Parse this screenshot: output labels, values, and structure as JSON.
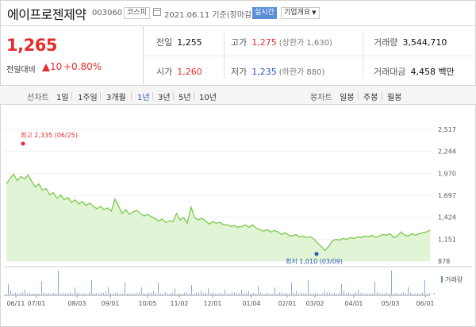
{
  "header": {
    "stock_name": "에이프로젠제약",
    "stock_code": "003060",
    "market": "코스피",
    "date_text": "2021.06.11 기준(장마감)",
    "live_label": "실시간",
    "overview_label": "기업개요"
  },
  "price": {
    "current": "1,265",
    "change_label": "전일대비",
    "change_value": "10",
    "change_pct": "+0.80%"
  },
  "stats": {
    "prev_close_label": "전일",
    "prev_close": "1,255",
    "high_label": "고가",
    "high": "1,275",
    "upper_limit": "(상한가 1,630)",
    "volume_label": "거래량",
    "volume": "3,544,710",
    "open_label": "시가",
    "open": "1,260",
    "low_label": "저가",
    "low": "1,235",
    "lower_limit": "(하한가 880)",
    "amount_label": "거래대금",
    "amount": "4,458 백만"
  },
  "toolbar": {
    "line_chart_label": "선차트",
    "periods": [
      "1일",
      "1주일",
      "3개월",
      "1년",
      "3년",
      "5년",
      "10년"
    ],
    "active_period": "1년",
    "candle_label": "봉차트",
    "candles": [
      "일봉",
      "주봉",
      "월봉"
    ]
  },
  "colors": {
    "up": "#e42d2d",
    "down": "#2859b8",
    "line": "#7cc94b",
    "area": "#e2f4d6"
  },
  "chart_data": {
    "type": "area",
    "y_ticks": [
      "2,517",
      "2,244",
      "1,970",
      "1,697",
      "1,424",
      "1,151",
      "878"
    ],
    "ylim": [
      878,
      2517
    ],
    "x_ticks": [
      "06/11",
      "07/01",
      "08/03",
      "09/01",
      "10/05",
      "11/02",
      "12/01",
      "01/04",
      "02/01",
      "03/02",
      "04/01",
      "05/03",
      "06/01"
    ],
    "high_label": "최고 2,335 (06/25)",
    "low_label": "최저 1,010 (03/09)",
    "volume_label": "거래량",
    "series": [
      {
        "values": [
          1840,
          1905,
          1960,
          1880,
          1930,
          1900,
          1950,
          1870,
          1800,
          1840,
          1760,
          1780,
          1700,
          1730,
          1660,
          1700,
          1640,
          1670,
          1610,
          1640,
          1590,
          1620,
          1570,
          1600,
          1560,
          1530,
          1560,
          1520,
          1540,
          1500,
          1650,
          1560,
          1470,
          1520,
          1460,
          1490,
          1510,
          1470,
          1440,
          1460,
          1430,
          1410,
          1380,
          1400,
          1360,
          1380,
          1370,
          1470,
          1390,
          1420,
          1350,
          1550,
          1420,
          1390,
          1410,
          1380,
          1340,
          1370,
          1350,
          1360,
          1330,
          1330,
          1310,
          1320,
          1300,
          1310,
          1330,
          1300,
          1330,
          1290,
          1270,
          1250,
          1270,
          1240,
          1260,
          1240,
          1210,
          1230,
          1200,
          1190,
          1210,
          1180,
          1190,
          1170,
          1180,
          1150,
          1100,
          1060,
          1010,
          1060,
          1130,
          1150,
          1140,
          1160,
          1150,
          1170,
          1160,
          1180,
          1170,
          1190,
          1180,
          1200,
          1170,
          1190,
          1210,
          1200,
          1220,
          1170,
          1190,
          1240,
          1200,
          1190,
          1220,
          1200,
          1220,
          1230,
          1240,
          1265
        ]
      }
    ],
    "volume_peaks": [
      0.45,
      1.0,
      0.3,
      0.5,
      0.25,
      0.35,
      0.6,
      0.2,
      0.3,
      0.5,
      0.25,
      0.2,
      0.3,
      0.15,
      0.55,
      0.6,
      0.3,
      0.4,
      0.2,
      0.5
    ]
  }
}
